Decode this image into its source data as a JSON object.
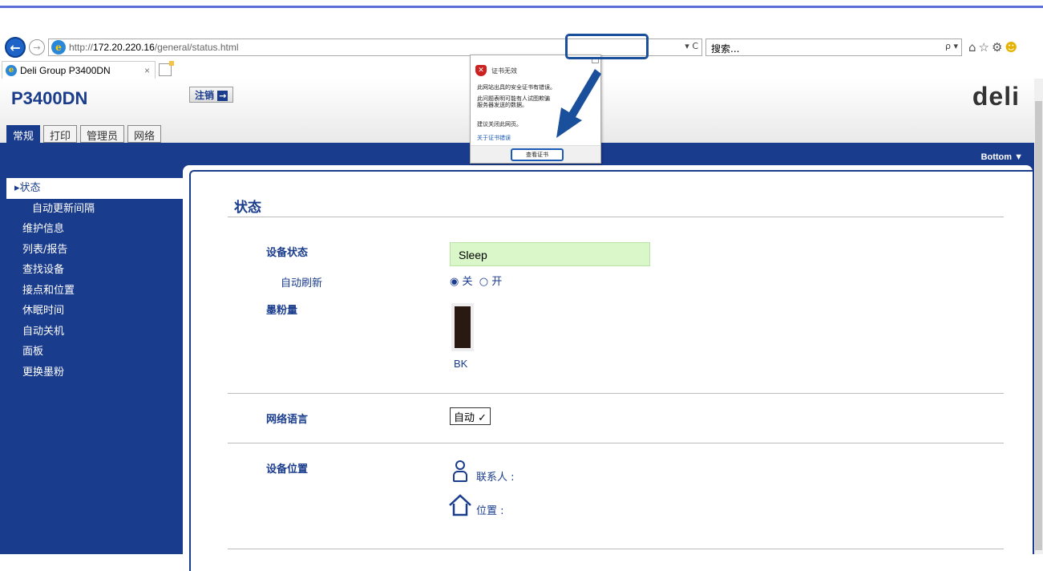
{
  "browser": {
    "url_prefix": "http://",
    "url_host": "172.20.220.16",
    "url_path": "/general/status.html",
    "addr_tools": "▾ C",
    "search_placeholder": "搜索...",
    "search_tools": "ρ ▾",
    "tab_title": "Deli Group P3400DN",
    "tab_close": "×"
  },
  "header": {
    "model": "P3400DN",
    "logout_label": "注销",
    "brand_logo": "deli",
    "tabs": [
      "常规",
      "打印",
      "管理员",
      "网络"
    ],
    "active_tab": "常规"
  },
  "bottom_link": "Bottom ▼",
  "sidebar": {
    "items": [
      {
        "label": "▸状态",
        "active": true,
        "sub": false
      },
      {
        "label": "自动更新间隔",
        "active": false,
        "sub": true
      },
      {
        "label": "维护信息",
        "active": false,
        "sub": false
      },
      {
        "label": "列表/报告",
        "active": false,
        "sub": false
      },
      {
        "label": "查找设备",
        "active": false,
        "sub": false
      },
      {
        "label": "接点和位置",
        "active": false,
        "sub": false
      },
      {
        "label": "休眠时间",
        "active": false,
        "sub": false
      },
      {
        "label": "自动关机",
        "active": false,
        "sub": false
      },
      {
        "label": "面板",
        "active": false,
        "sub": false
      },
      {
        "label": "更换墨粉",
        "active": false,
        "sub": false
      }
    ]
  },
  "main": {
    "title": "状态",
    "device_status_label": "设备状态",
    "device_status_value": "Sleep",
    "auto_refresh_label": "自动刷新",
    "auto_refresh_off": "关",
    "auto_refresh_on": "开",
    "toner_label": "墨粉量",
    "toner_name": "BK",
    "toner_level": 1.0,
    "web_language_label": "网络语言",
    "web_language_value": "自动",
    "device_location_label": "设备位置",
    "contact_label": "联系人 :",
    "location_label": "位置 :"
  },
  "cert_popup": {
    "title": "证书无效",
    "line1": "此网站出具的安全证书有错误。",
    "line2a": "此问题表明可能有人试图欺骗",
    "line2b": "服务器发送的数据。",
    "line3": "建议关闭此网页。",
    "link": "关于证书错误",
    "button": "查看证书"
  },
  "colors": {
    "brand_blue": "#1a3c8c",
    "status_green": "#d9f7c9",
    "toner_black": "#2a1812",
    "highlight": "#1a4f9c"
  }
}
